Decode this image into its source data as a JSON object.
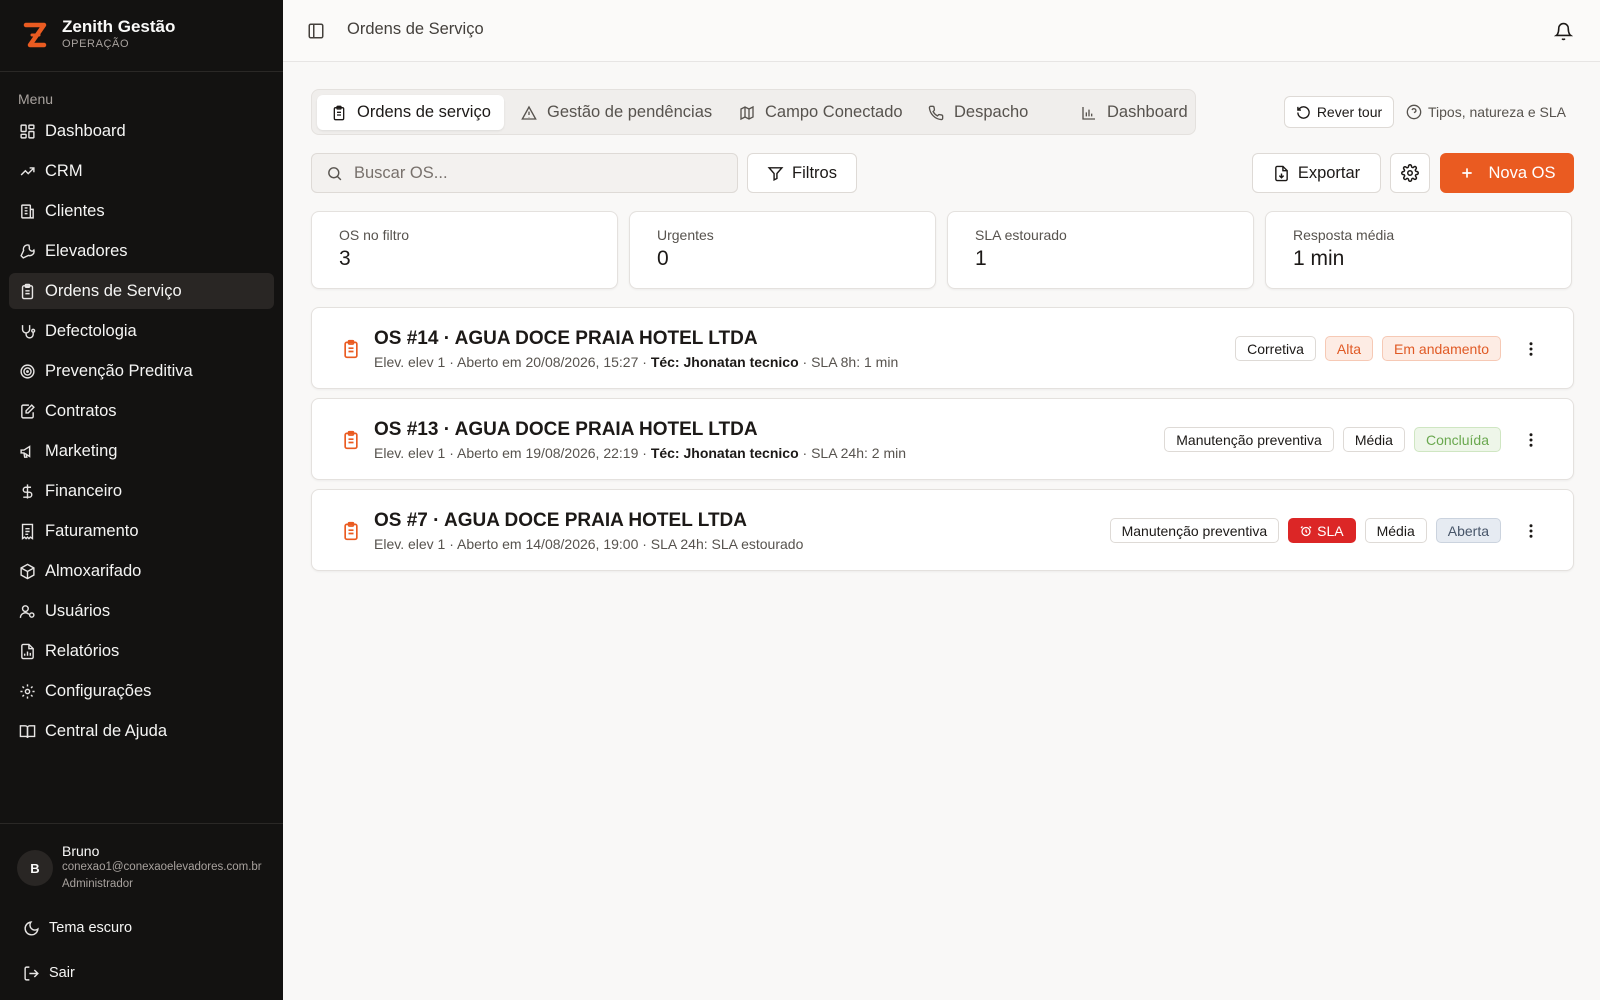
{
  "brand": {
    "name": "Zenith Gestão",
    "subtitle": "OPERAÇÃO",
    "accent": "#ea5b21"
  },
  "sidebar": {
    "menu_title": "Menu",
    "items": [
      {
        "label": "Dashboard",
        "icon": "dashboard-grid-icon",
        "active": false
      },
      {
        "label": "CRM",
        "icon": "trending-up-icon",
        "active": false
      },
      {
        "label": "Clientes",
        "icon": "building-icon",
        "active": false
      },
      {
        "label": "Elevadores",
        "icon": "wrench-icon",
        "active": false
      },
      {
        "label": "Ordens de Serviço",
        "icon": "clipboard-icon",
        "active": true
      },
      {
        "label": "Defectologia",
        "icon": "stethoscope-icon",
        "active": false
      },
      {
        "label": "Prevenção Preditiva",
        "icon": "target-icon",
        "active": false
      },
      {
        "label": "Contratos",
        "icon": "file-edit-icon",
        "active": false
      },
      {
        "label": "Marketing",
        "icon": "megaphone-icon",
        "active": false
      },
      {
        "label": "Financeiro",
        "icon": "dollar-icon",
        "active": false
      },
      {
        "label": "Faturamento",
        "icon": "receipt-icon",
        "active": false
      },
      {
        "label": "Almoxarifado",
        "icon": "package-icon",
        "active": false
      },
      {
        "label": "Usuários",
        "icon": "user-cog-icon",
        "active": false
      },
      {
        "label": "Relatórios",
        "icon": "file-chart-icon",
        "active": false
      },
      {
        "label": "Configurações",
        "icon": "gear-icon",
        "active": false
      },
      {
        "label": "Central de Ajuda",
        "icon": "book-open-icon",
        "active": false
      }
    ],
    "user": {
      "initial": "B",
      "name": "Bruno",
      "email": "conexao1@conexaoelevadores.com.br",
      "role": "Administrador"
    },
    "theme_label": "Tema escuro",
    "logout_label": "Sair"
  },
  "header": {
    "title": "Ordens de Serviço"
  },
  "tabs": [
    {
      "label": "Ordens de serviço",
      "icon": "clipboard-icon",
      "active": true
    },
    {
      "label": "Gestão de pendências",
      "icon": "alert-triangle-icon",
      "active": false
    },
    {
      "label": "Campo Conectado",
      "icon": "map-icon",
      "active": false
    },
    {
      "label": "Despacho",
      "icon": "phone-icon",
      "active": false
    },
    {
      "label": "Dashboard",
      "icon": "bar-chart-icon",
      "active": false
    }
  ],
  "actions": {
    "tour_label": "Rever tour",
    "types_label": "Tipos, natureza e SLA"
  },
  "toolbar": {
    "search_placeholder": "Buscar OS...",
    "search_value": "",
    "filters_label": "Filtros",
    "export_label": "Exportar",
    "new_label": "Nova OS"
  },
  "stats": [
    {
      "label": "OS no filtro",
      "value": "3"
    },
    {
      "label": "Urgentes",
      "value": "0"
    },
    {
      "label": "SLA estourado",
      "value": "1"
    },
    {
      "label": "Resposta média",
      "value": "1 min"
    }
  ],
  "orders": [
    {
      "title": "OS #14 · AGUA DOCE PRAIA HOTEL LTDA",
      "sub_pre": "Elev. elev 1 · Aberto em 20/08/2026, 15:27 · ",
      "tech": "Téc: Jhonatan tecnico",
      "sub_post": " · SLA 8h: 1 min",
      "badges": [
        {
          "label": "Corretiva",
          "style": "default"
        },
        {
          "label": "Alta",
          "style": "alta"
        },
        {
          "label": "Em andamento",
          "style": "andamento"
        }
      ]
    },
    {
      "title": "OS #13 · AGUA DOCE PRAIA HOTEL LTDA",
      "sub_pre": "Elev. elev 1 · Aberto em 19/08/2026, 22:19 · ",
      "tech": "Téc: Jhonatan tecnico",
      "sub_post": " · SLA 24h: 2 min",
      "badges": [
        {
          "label": "Manutenção preventiva",
          "style": "default"
        },
        {
          "label": "Média",
          "style": "default"
        },
        {
          "label": "Concluída",
          "style": "concluida"
        }
      ]
    },
    {
      "title": "OS #7 · AGUA DOCE PRAIA HOTEL LTDA",
      "sub_pre": "Elev. elev 1 · Aberto em 14/08/2026, 19:00 · SLA 24h: SLA estourado",
      "tech": "",
      "sub_post": "",
      "badges": [
        {
          "label": "Manutenção preventiva",
          "style": "default"
        },
        {
          "label": "SLA",
          "style": "sla",
          "icon": "alarm-clock-icon"
        },
        {
          "label": "Média",
          "style": "default"
        },
        {
          "label": "Aberta",
          "style": "aberta"
        }
      ]
    }
  ]
}
